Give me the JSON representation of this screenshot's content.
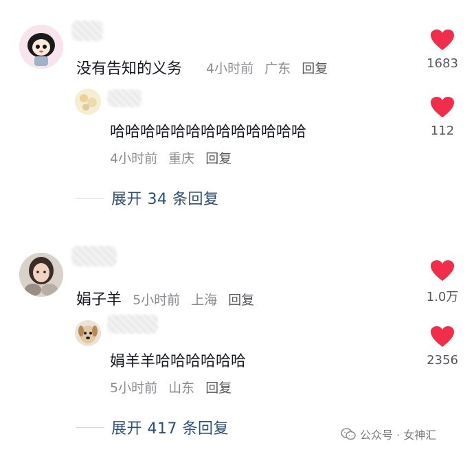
{
  "comments": [
    {
      "text": "没有告知的义务",
      "time": "4小时前",
      "location": "广东",
      "reply_label": "回复",
      "likes": "1683",
      "replies": [
        {
          "text": "哈哈哈哈哈哈哈哈哈哈哈哈哈",
          "time": "4小时前",
          "location": "重庆",
          "reply_label": "回复",
          "likes": "112"
        }
      ],
      "expand_label": "展开 34 条回复"
    },
    {
      "author": "娟子羊",
      "time": "5小时前",
      "location": "上海",
      "reply_label": "回复",
      "likes": "1.0万",
      "replies": [
        {
          "text": "娟羊羊哈哈哈哈哈哈",
          "time": "5小时前",
          "location": "山东",
          "reply_label": "回复",
          "likes": "2356"
        }
      ],
      "expand_label": "展开 417 条回复"
    }
  ],
  "watermark": "公众号 · 女神汇",
  "colors": {
    "heart": "#f02d4a",
    "link": "#2a4e78",
    "meta": "#8a8b91"
  },
  "icons": [
    "heart-icon",
    "wechat-icon"
  ]
}
